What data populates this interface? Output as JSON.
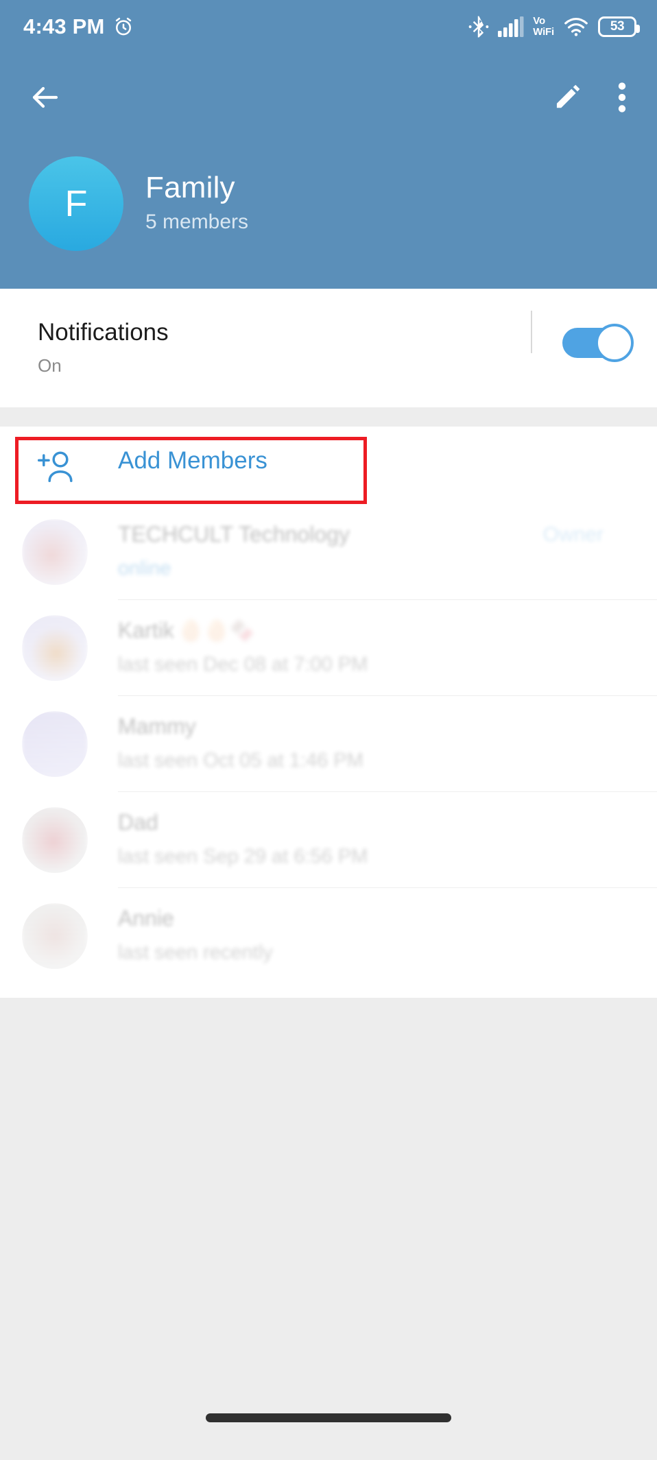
{
  "status_bar": {
    "time": "4:43 PM",
    "alarm_icon": "alarm-clock-icon",
    "bluetooth_icon": "bluetooth-icon",
    "signal_icon": "cellular-signal-icon",
    "vo_label": "Vo",
    "wifi_label": "WiFi",
    "wifi_icon": "wifi-icon",
    "battery_level": "53"
  },
  "action_bar": {
    "back_icon": "back-arrow-icon",
    "edit_icon": "pencil-edit-icon",
    "more_icon": "more-vertical-icon"
  },
  "group": {
    "avatar_initial": "F",
    "name": "Family",
    "members_count": "5 members"
  },
  "notifications": {
    "title": "Notifications",
    "state": "On",
    "toggle_on": true,
    "accent_color": "#4fa3e3"
  },
  "add_members": {
    "label": "Add Members",
    "icon": "add-person-icon",
    "highlight_color": "#ed1c24",
    "text_color": "#3992d4"
  },
  "members": [
    {
      "name": "TECHCULT Technology",
      "status": "online",
      "status_type": "online",
      "badge": "Owner",
      "avatar_class": "av-a",
      "emoji": ""
    },
    {
      "name": "Kartik",
      "status": "last seen Dec 08 at 7:00 PM",
      "status_type": "last_seen",
      "badge": "",
      "avatar_class": "av-b",
      "emoji": "🥚🥚🍫"
    },
    {
      "name": "Mammy",
      "status": "last seen Oct 05 at 1:46 PM",
      "status_type": "last_seen",
      "badge": "",
      "avatar_class": "av-c",
      "emoji": ""
    },
    {
      "name": "Dad",
      "status": "last seen Sep 29 at 6:56 PM",
      "status_type": "last_seen",
      "badge": "",
      "avatar_class": "av-d",
      "emoji": ""
    },
    {
      "name": "Annie",
      "status": "last seen recently",
      "status_type": "last_seen",
      "badge": "",
      "avatar_class": "av-e",
      "emoji": ""
    }
  ],
  "system_nav": {
    "gesture_pill": "home-gesture-pill"
  },
  "theme": {
    "header_blue": "#5b8fb9",
    "page_gray": "#ededed",
    "card_white": "#ffffff"
  }
}
